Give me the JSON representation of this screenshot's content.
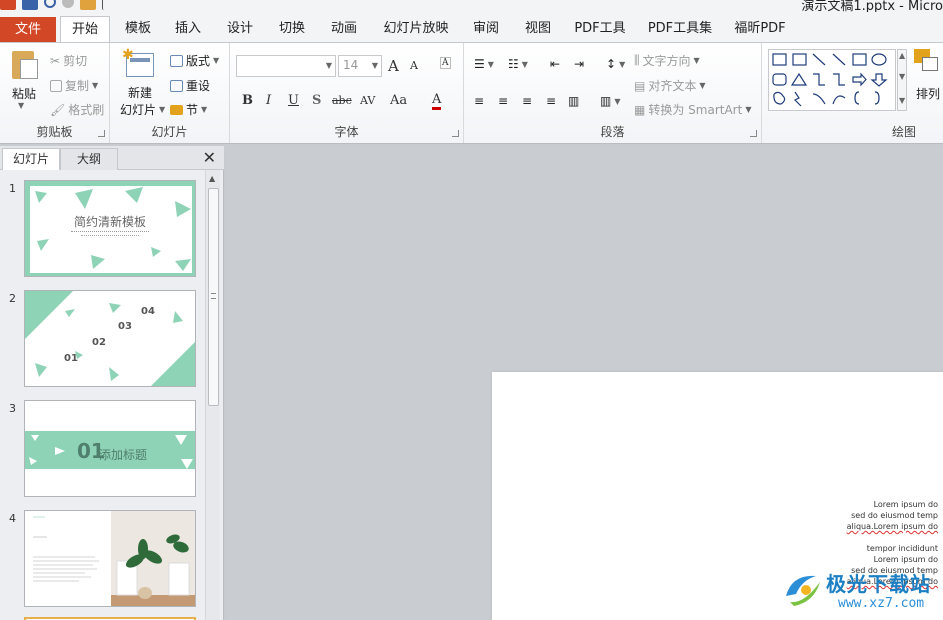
{
  "window": {
    "title": "演示文稿1.pptx - Micro"
  },
  "tabs": [
    "文件",
    "开始",
    "模板",
    "插入",
    "设计",
    "切换",
    "动画",
    "幻灯片放映",
    "审阅",
    "视图",
    "PDF工具",
    "PDF工具集",
    "福昕PDF"
  ],
  "clipboard": {
    "paste": "粘贴",
    "cut": "剪切",
    "copy": "复制",
    "format_painter": "格式刷",
    "label": "剪贴板"
  },
  "slides_group": {
    "new_slide_1": "新建",
    "new_slide_2": "幻灯片",
    "layout": "版式",
    "reset": "重设",
    "section": "节",
    "label": "幻灯片"
  },
  "font": {
    "size": "14",
    "label": "字体",
    "bold": "B",
    "italic": "I",
    "underline": "U",
    "shadow": "S",
    "strike": "abc",
    "spacing": "AV",
    "case": "Aa",
    "color": "A",
    "grow": "A",
    "shrink": "A"
  },
  "paragraph": {
    "text_direction": "文字方向",
    "align_text": "对齐文本",
    "smartart": "转换为 SmartArt",
    "label": "段落"
  },
  "drawing": {
    "arrange": "排列",
    "label": "绘图"
  },
  "pane": {
    "tab_slides": "幻灯片",
    "tab_outline": "大纲"
  },
  "slides": [
    {
      "num": "1",
      "title": "简约清新模板"
    },
    {
      "num": "2",
      "items": [
        "01",
        "02",
        "03",
        "04"
      ]
    },
    {
      "num": "3",
      "num_text": "01",
      "title": "添加标题"
    },
    {
      "num": "4"
    }
  ],
  "canvas": {
    "lines": [
      "Lorem ipsum do",
      "sed do eiusmod temp",
      "aliqua.Lorem ipsum do",
      "tempor incididunt",
      "Lorem ipsum do",
      "sed do eiusmod temp",
      "aliqua.Lorem ipsum do"
    ]
  },
  "watermark": {
    "text": "极光下载站",
    "url": "www.xz7.com"
  },
  "colors": {
    "accent": "#8fd3b6",
    "file_tab": "#d24726",
    "selection": "#e8b04a"
  }
}
